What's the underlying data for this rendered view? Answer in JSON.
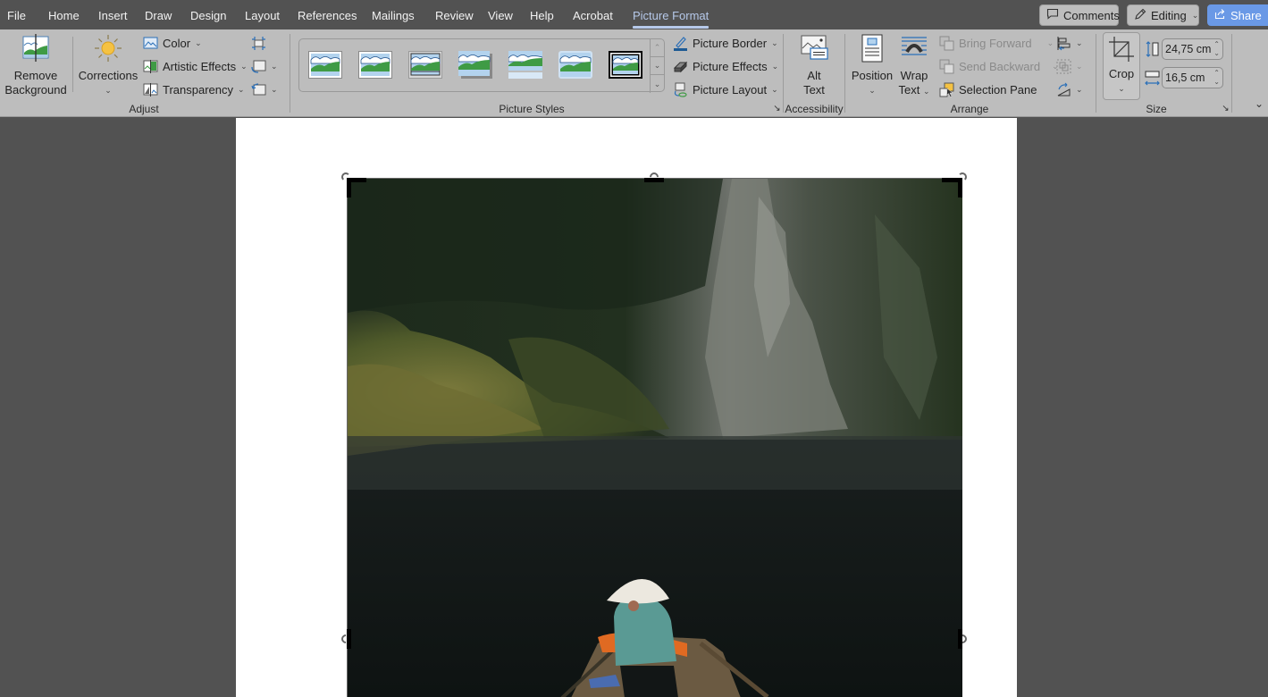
{
  "menubar": {
    "tabs": [
      {
        "label": "File"
      },
      {
        "label": "Home"
      },
      {
        "label": "Insert"
      },
      {
        "label": "Draw"
      },
      {
        "label": "Design"
      },
      {
        "label": "Layout"
      },
      {
        "label": "References"
      },
      {
        "label": "Mailings"
      },
      {
        "label": "Review"
      },
      {
        "label": "View"
      },
      {
        "label": "Help"
      },
      {
        "label": "Acrobat"
      },
      {
        "label": "Picture Format",
        "active": true
      }
    ],
    "comments_label": "Comments",
    "editing_label": "Editing",
    "share_label": "Share",
    "accent_color": "#b6c9ea",
    "share_color": "#6a99e6"
  },
  "ribbon": {
    "adjust": {
      "label": "Adjust",
      "remove_background": "Remove Background",
      "remove_background_line1": "Remove",
      "remove_background_line2": "Background",
      "corrections": "Corrections",
      "color": "Color",
      "artistic_effects": "Artistic Effects",
      "transparency": "Transparency",
      "compress_pictures_icon": "compress-pictures-icon",
      "change_picture_icon": "change-picture-icon",
      "reset_picture_icon": "reset-picture-icon"
    },
    "picture_styles": {
      "label": "Picture Styles",
      "gallery": [
        {
          "name": "Simple Frame, White"
        },
        {
          "name": "Beveled Matte, White"
        },
        {
          "name": "Metal Frame"
        },
        {
          "name": "Drop Shadow Rectangle"
        },
        {
          "name": "Reflected Rounded Rectangle"
        },
        {
          "name": "Soft Edge Rectangle"
        },
        {
          "name": "Double Frame, Black",
          "selected": true
        }
      ],
      "picture_border": "Picture Border",
      "picture_effects": "Picture Effects",
      "picture_layout": "Picture Layout"
    },
    "accessibility": {
      "label": "Accessibility",
      "alt_text_line1": "Alt",
      "alt_text_line2": "Text"
    },
    "arrange": {
      "label": "Arrange",
      "position": "Position",
      "wrap_text_line1": "Wrap",
      "wrap_text_line2": "Text",
      "bring_forward": "Bring Forward",
      "send_backward": "Send Backward",
      "selection_pane": "Selection Pane",
      "align_icon": "align-icon",
      "group_icon": "group-icon",
      "rotate_icon": "rotate-icon"
    },
    "size": {
      "label": "Size",
      "crop": "Crop",
      "height_value": "24,75 cm",
      "width_value": "16,5 cm"
    }
  }
}
